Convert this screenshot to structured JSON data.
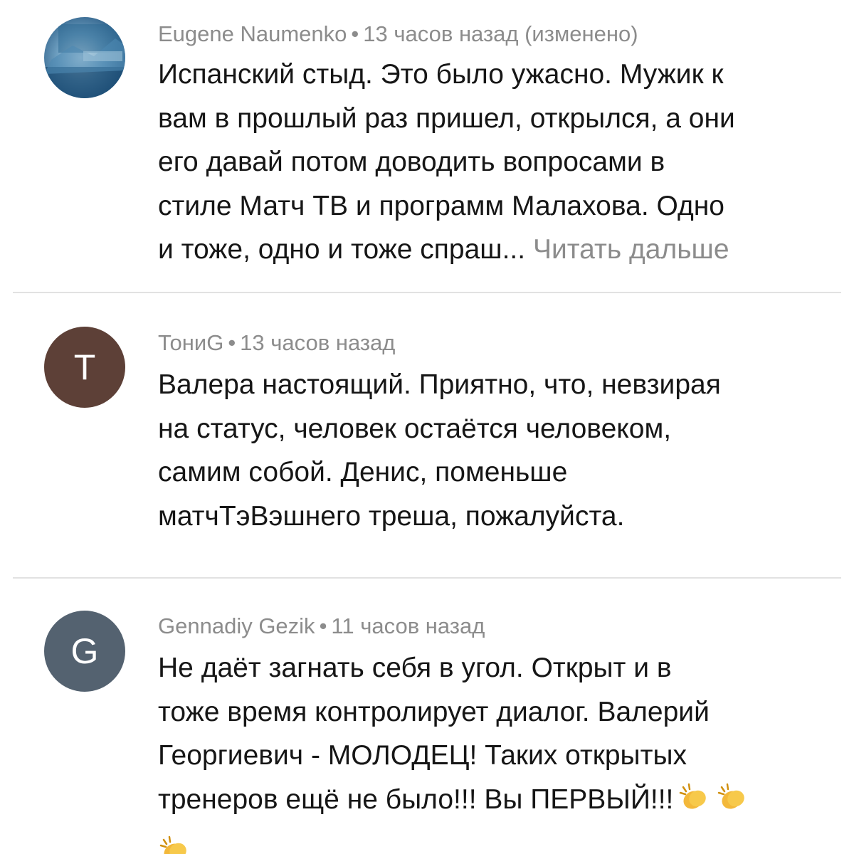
{
  "comments": [
    {
      "author": "Eugene Naumenko",
      "time": "13 часов назад (изменено)",
      "avatar": {
        "type": "photo",
        "icon": "profile-photo"
      },
      "lines": [
        "Испанский стыд. Это было ужасно. Мужик к",
        "вам в прошлый раз пришел, открылся, а они",
        "его давай потом доводить вопросами в",
        "стиле Матч ТВ и программ Малахова. Одно",
        "и тоже, одно и тоже спраш..."
      ],
      "read_more": "Читать дальше"
    },
    {
      "author": "ТониG",
      "time": "13 часов назад",
      "avatar": {
        "type": "letter",
        "letter": "T",
        "color": "#5d4037"
      },
      "lines": [
        "Валера настоящий. Приятно, что, невзирая",
        "на статус, человек остаётся человеком,",
        "самим собой. Денис, поменьше",
        "матчТэВэшнего треша, пожалуйста."
      ]
    },
    {
      "author": "Gennadiy Gezik",
      "time": "11 часов назад",
      "avatar": {
        "type": "letter",
        "letter": "G",
        "color": "#546270"
      },
      "lines": [
        "Не даёт загнать себя в угол. Открыт и в",
        "тоже время контролирует диалог. Валерий",
        "Георгиевич - МОЛОДЕЦ! Таких открытых",
        "тренеров ещё не было!!! Вы ПЕРВЫЙ!!!"
      ],
      "emoji": "clapping-hands-icon"
    }
  ],
  "separator": "•"
}
